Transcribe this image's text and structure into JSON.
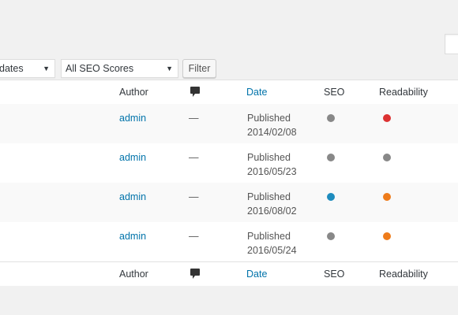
{
  "filters": {
    "dates_select": "dates",
    "seo_select": "All SEO Scores",
    "filter_button": "Filter"
  },
  "table": {
    "headers": {
      "author": "Author",
      "date": "Date",
      "seo": "SEO",
      "readability": "Readability"
    },
    "rows": [
      {
        "author": "admin",
        "comments": "—",
        "status": "Published",
        "date": "2014/02/08",
        "seo_color": "#888888",
        "readability_color": "#dc3232"
      },
      {
        "author": "admin",
        "comments": "—",
        "status": "Published",
        "date": "2016/05/23",
        "seo_color": "#888888",
        "readability_color": "#888888"
      },
      {
        "author": "admin",
        "comments": "—",
        "status": "Published",
        "date": "2016/08/02",
        "seo_color": "#1e8cbe",
        "readability_color": "#ee7c1b"
      },
      {
        "author": "admin",
        "comments": "—",
        "status": "Published",
        "date": "2016/05/24",
        "seo_color": "#888888",
        "readability_color": "#ee7c1b"
      }
    ]
  },
  "icons": {
    "comments": "comment-bubble-icon",
    "dropdown": "dropdown-arrow-icon"
  }
}
